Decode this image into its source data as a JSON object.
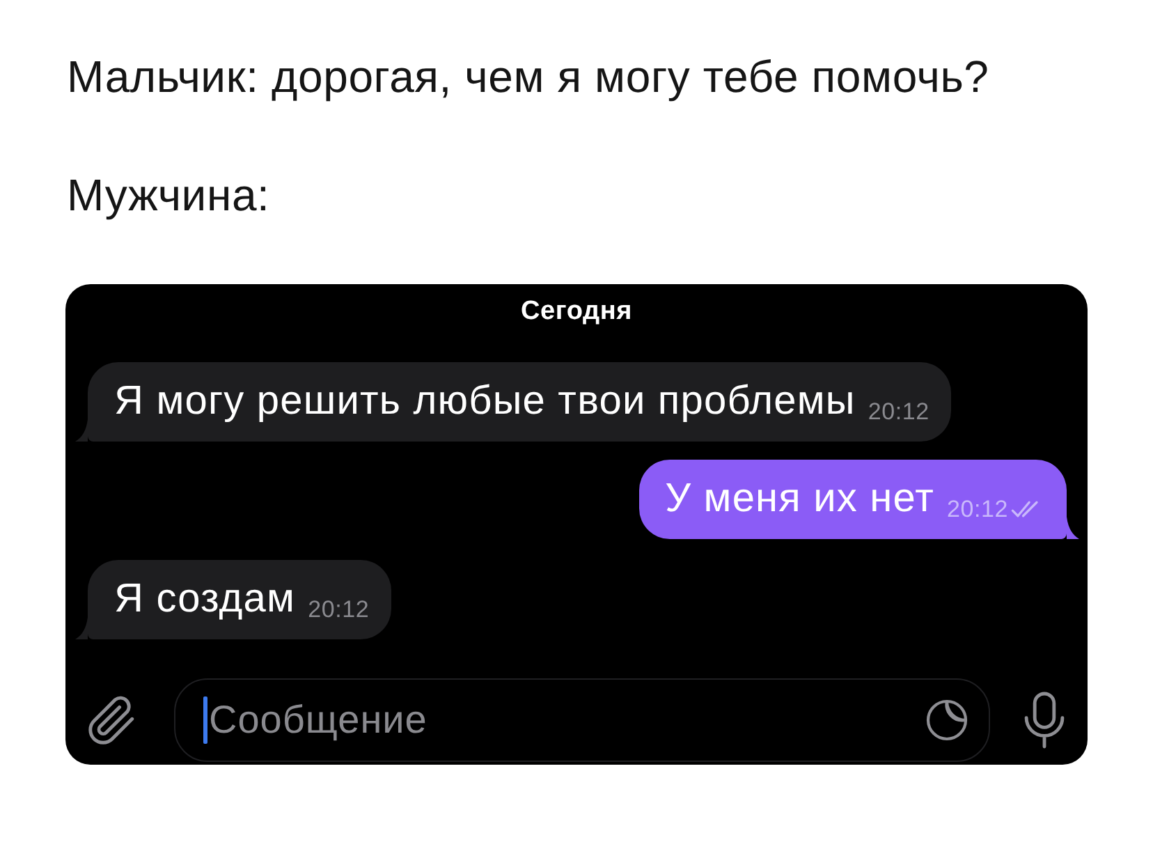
{
  "caption": {
    "lines": [
      "Мальчик: дорогая, чем я могу тебе помочь?",
      "Мужчина:"
    ]
  },
  "chat": {
    "date_label": "Сегодня",
    "messages": [
      {
        "kind": "incoming",
        "text": "Я могу решить любые твои проблемы",
        "time": "20:12"
      },
      {
        "kind": "outgoing",
        "text": "У меня их нет",
        "time": "20:12",
        "read": true
      },
      {
        "kind": "incoming",
        "text": "Я создам",
        "time": "20:12"
      }
    ],
    "composer": {
      "placeholder": "Сообщение",
      "focused": true
    }
  }
}
